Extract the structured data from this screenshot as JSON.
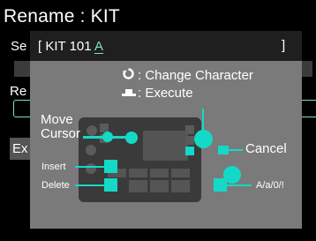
{
  "background": {
    "title": "Rename : KIT",
    "row1_text": "Se",
    "row2_text": "Re",
    "button_text": "Ex"
  },
  "dialog": {
    "bracket_left": "[",
    "name_prefix": "KIT 101 ",
    "cursor_char": "A",
    "bracket_right": "]",
    "legend": {
      "change_icon": "rotate-knob-icon",
      "change_text": ": Change Character",
      "execute_icon": "press-button-icon",
      "execute_text": ": Execute"
    },
    "labels": {
      "move_cursor_line1": "Move",
      "move_cursor_line2": "Cursor",
      "cancel": "Cancel",
      "insert": "Insert",
      "delete": "Delete",
      "case": "A/a/0/!"
    },
    "accent_color": "#14d9c7"
  }
}
